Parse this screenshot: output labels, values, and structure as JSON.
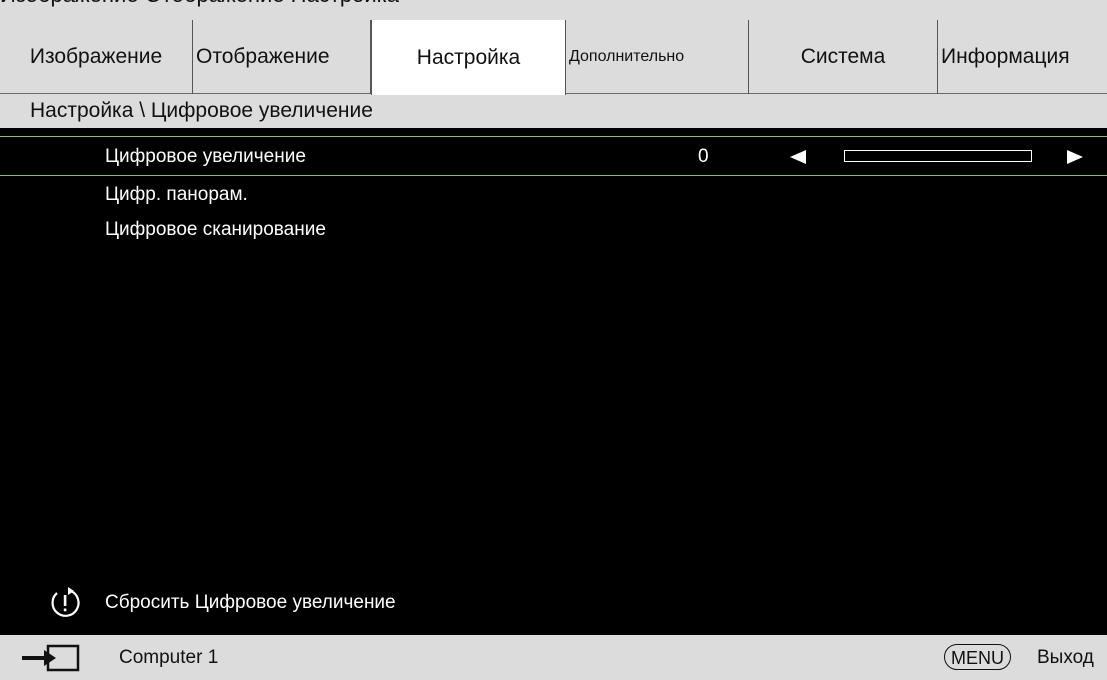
{
  "header_strip": {
    "text": "Изображение Отображение Настройка"
  },
  "tabs": [
    {
      "label": "Изображение",
      "active": false
    },
    {
      "label": "Отображение",
      "active": false
    },
    {
      "label": "Настройка",
      "active": true
    },
    {
      "label": "Дополнительно",
      "active": false
    },
    {
      "label": "Система",
      "active": false
    },
    {
      "label": "Информация",
      "active": false
    }
  ],
  "breadcrumb": "Настройка \\ Цифровое увеличение",
  "menu": {
    "selected_item": {
      "label": "Цифровое увеличение",
      "value": "0",
      "slider_fraction": 0
    },
    "items": [
      {
        "label": "Цифр. панорам."
      },
      {
        "label": "Цифровое сканирование"
      }
    ],
    "reset_label": "Сбросить Цифровое увеличение",
    "reset_icon": "reset-icon"
  },
  "footer": {
    "source_icon": "input-source-icon",
    "source": "Computer 1",
    "menu_key": "MENU",
    "exit_label": "Выход"
  },
  "colors": {
    "selection_border": "#8fbf4f",
    "tab_bg": "#dcdcdc",
    "active_tab_bg": "#ffffff",
    "menu_bg": "#000000"
  }
}
